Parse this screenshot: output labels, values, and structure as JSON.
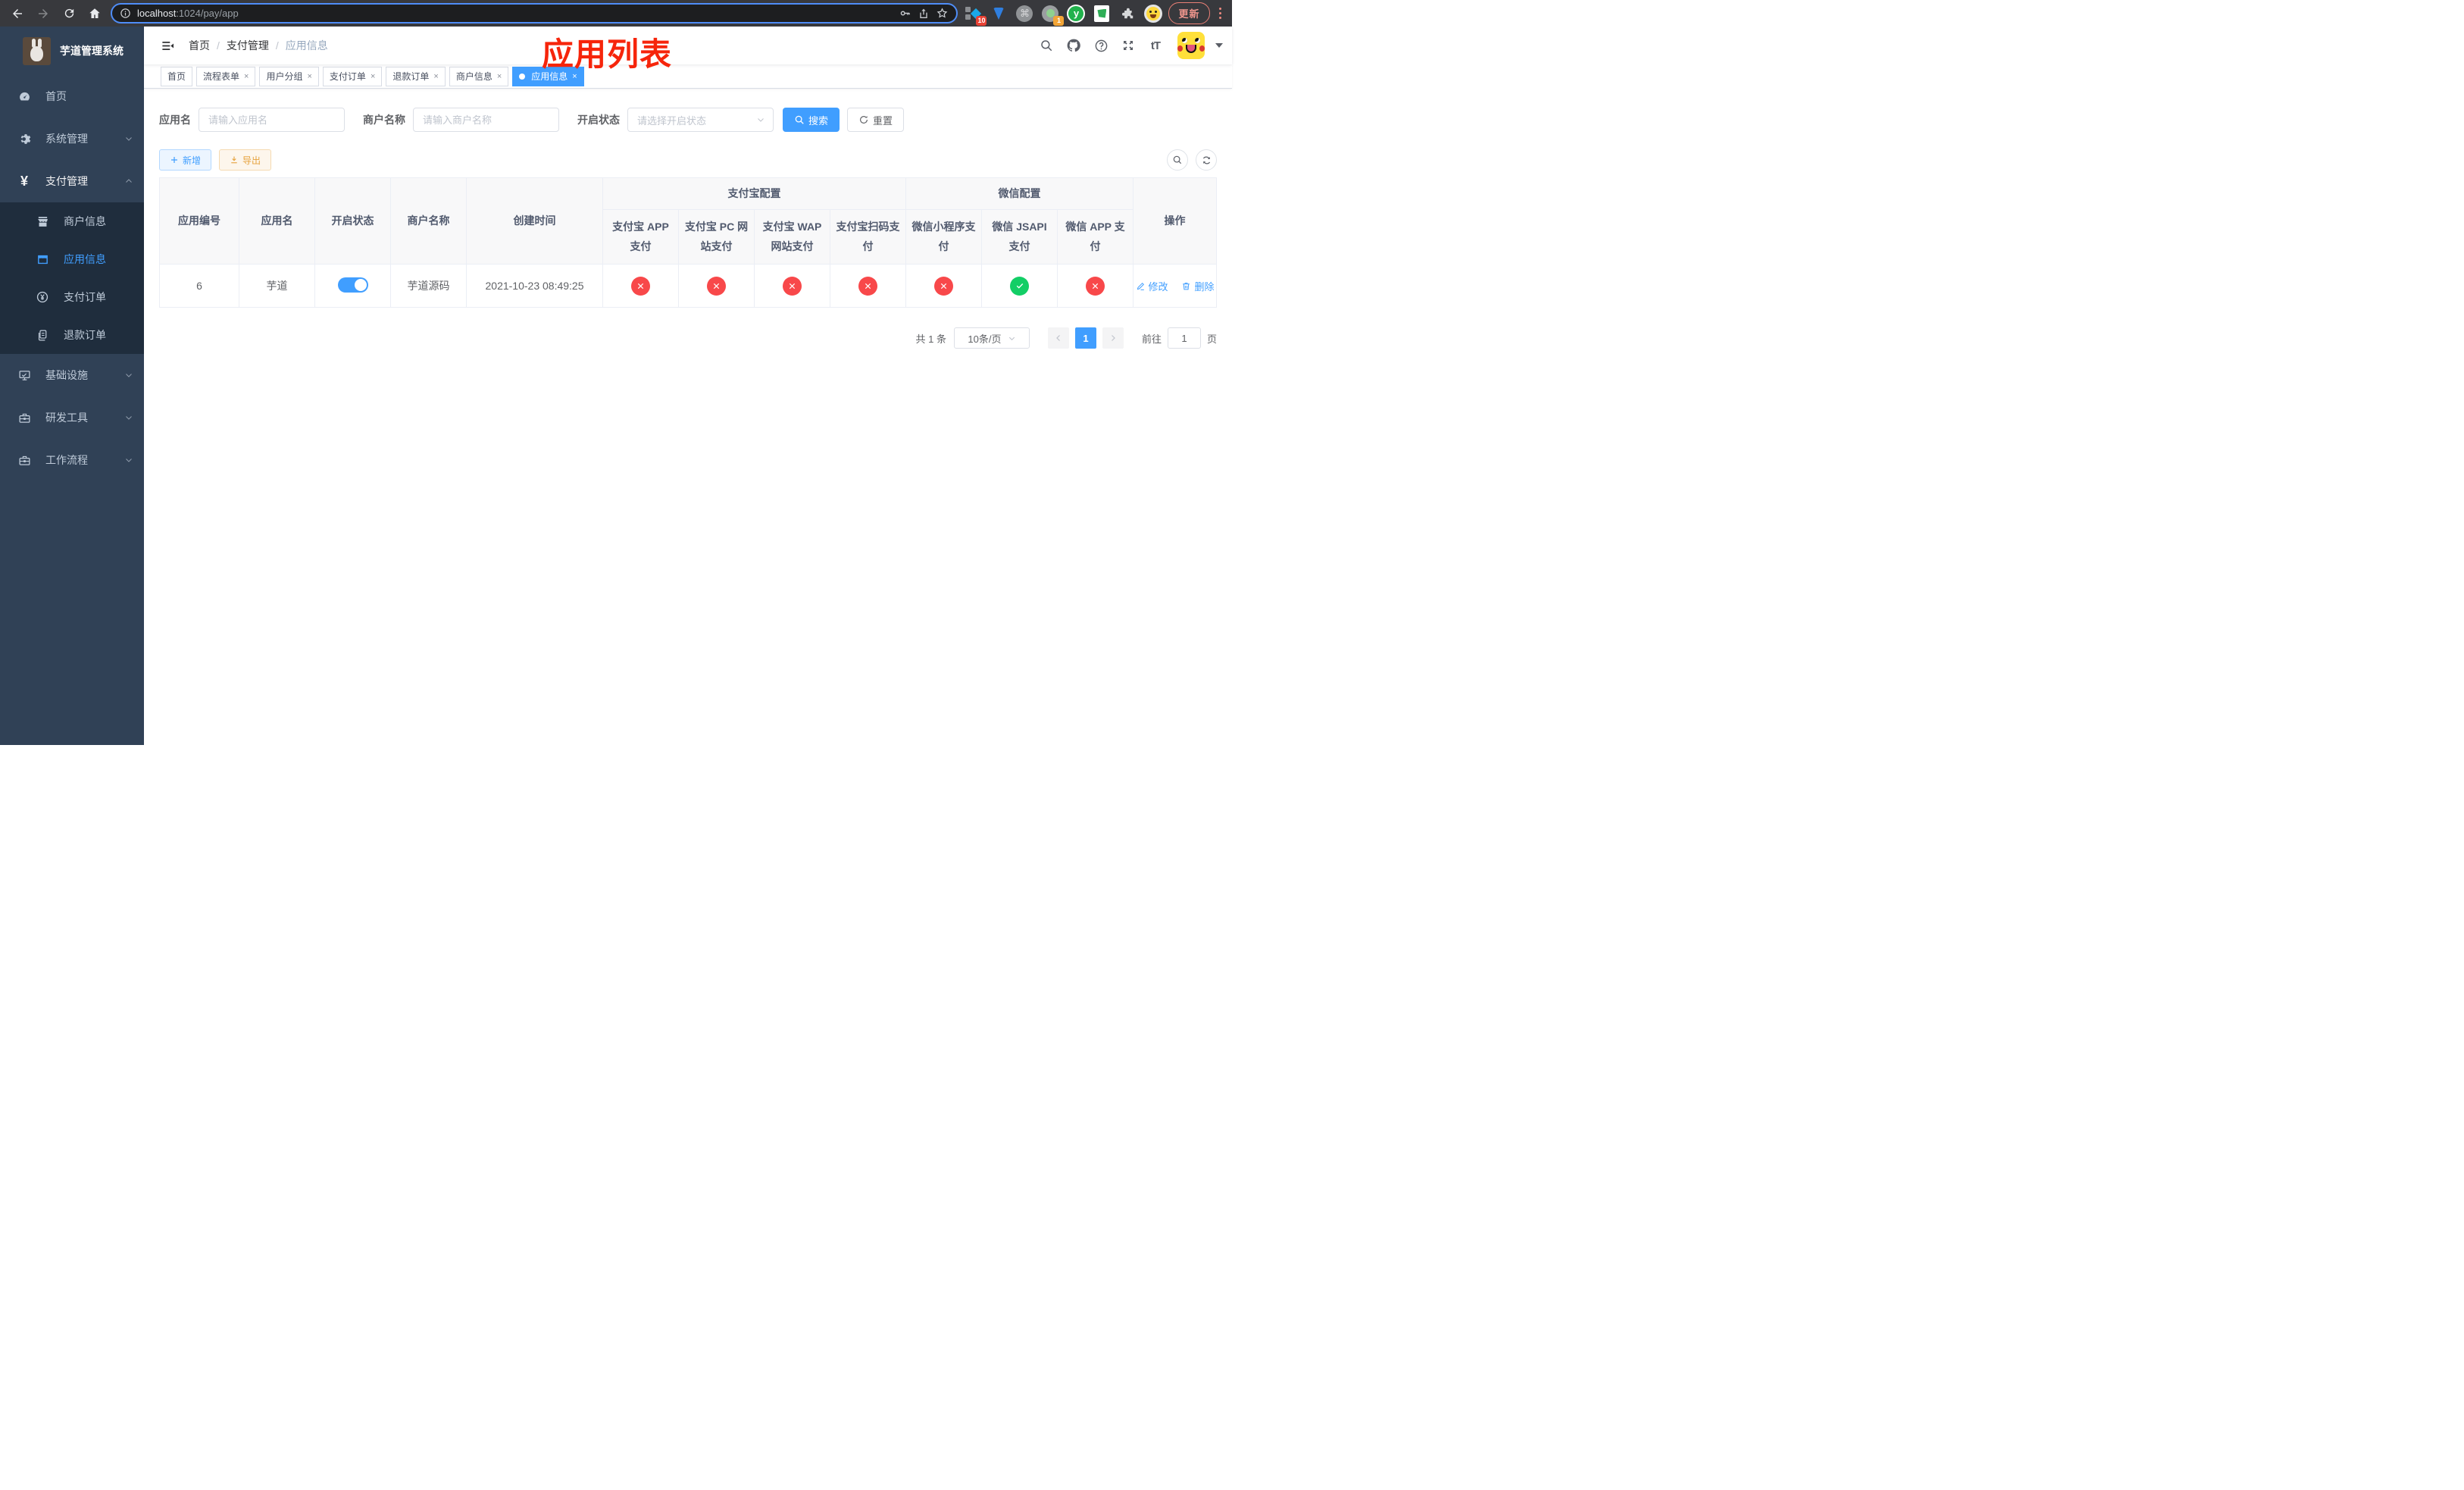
{
  "colors": {
    "accent": "#409eff",
    "success": "#13ce66",
    "danger": "#f8484a",
    "annotation": "#f6250b",
    "export": "#e6a23c",
    "sidebar_bg": "#304156",
    "submenu_bg": "#1f2d3d"
  },
  "browser": {
    "url_host": "localhost",
    "url_rest": ":1024/pay/app",
    "update_label": "更新",
    "ext_badge_1": "10",
    "ext_badge_2": "1",
    "ext_y_letter": "y",
    "ext_cmd_glyph": "⌘"
  },
  "sidebar": {
    "title": "芋道管理系统",
    "items": [
      {
        "label": "首页",
        "icon": "dashboard-icon"
      },
      {
        "label": "系统管理",
        "icon": "gear-icon",
        "chevron": "down"
      },
      {
        "label": "支付管理",
        "icon": "yen-icon",
        "chevron": "up",
        "expanded": true
      },
      {
        "label": "商户信息",
        "icon": "shop-icon",
        "submenu": true
      },
      {
        "label": "应用信息",
        "icon": "grid-icon",
        "submenu": true,
        "active": true
      },
      {
        "label": "支付订单",
        "icon": "coin-icon",
        "submenu": true
      },
      {
        "label": "退款订单",
        "icon": "documents-icon",
        "submenu": true
      },
      {
        "label": "基础设施",
        "icon": "monitor-icon",
        "chevron": "down"
      },
      {
        "label": "研发工具",
        "icon": "toolbox-icon",
        "chevron": "down"
      },
      {
        "label": "工作流程",
        "icon": "workflow-icon",
        "chevron": "down"
      }
    ],
    "yen_glyph": "¥"
  },
  "header": {
    "breadcrumb": [
      "首页",
      "支付管理",
      "应用信息"
    ],
    "separator": "/",
    "annotation": "应用列表",
    "font_icon": "tT"
  },
  "tabs": [
    {
      "label": "首页",
      "closable": false
    },
    {
      "label": "流程表单",
      "closable": true
    },
    {
      "label": "用户分组",
      "closable": true
    },
    {
      "label": "支付订单",
      "closable": true
    },
    {
      "label": "退款订单",
      "closable": true
    },
    {
      "label": "商户信息",
      "closable": true
    },
    {
      "label": "应用信息",
      "closable": true,
      "active": true
    }
  ],
  "close_glyph": "×",
  "filters": {
    "app_name": {
      "label": "应用名",
      "placeholder": "请输入应用名",
      "value": ""
    },
    "merchant": {
      "label": "商户名称",
      "placeholder": "请输入商户名称",
      "value": ""
    },
    "status": {
      "label": "开启状态",
      "placeholder": "请选择开启状态",
      "value": ""
    },
    "search_label": "搜索",
    "reset_label": "重置"
  },
  "toolbar": {
    "add_label": "新增",
    "export_label": "导出"
  },
  "table": {
    "columns": [
      "应用编号",
      "应用名",
      "开启状态",
      "商户名称",
      "创建时间"
    ],
    "groups": [
      {
        "label": "支付宝配置",
        "children": [
          "支付宝 APP 支付",
          "支付宝 PC 网站支付",
          "支付宝 WAP 网站支付",
          "支付宝扫码支付"
        ]
      },
      {
        "label": "微信配置",
        "children": [
          "微信小程序支付",
          "微信 JSAPI 支付",
          "微信 APP 支付"
        ]
      }
    ],
    "ops_column": "操作",
    "row": {
      "app_id": "6",
      "app_name": "芋道",
      "enabled": true,
      "merchant_name": "芋道源码",
      "create_time": "2021-10-23 08:49:25",
      "channels": [
        {
          "name": "alipay-app",
          "enabled": false
        },
        {
          "name": "alipay-pc",
          "enabled": false
        },
        {
          "name": "alipay-wap",
          "enabled": false
        },
        {
          "name": "alipay-qr",
          "enabled": false
        },
        {
          "name": "wx-lite",
          "enabled": false
        },
        {
          "name": "wx-jsapi",
          "enabled": true
        },
        {
          "name": "wx-app",
          "enabled": false
        }
      ],
      "edit_label": "修改",
      "delete_label": "删除"
    }
  },
  "pagination": {
    "total_label": "共 1 条",
    "page_size_label": "10条/页",
    "current_page": "1",
    "goto_label": "前往",
    "goto_value": "1",
    "page_unit": "页"
  }
}
